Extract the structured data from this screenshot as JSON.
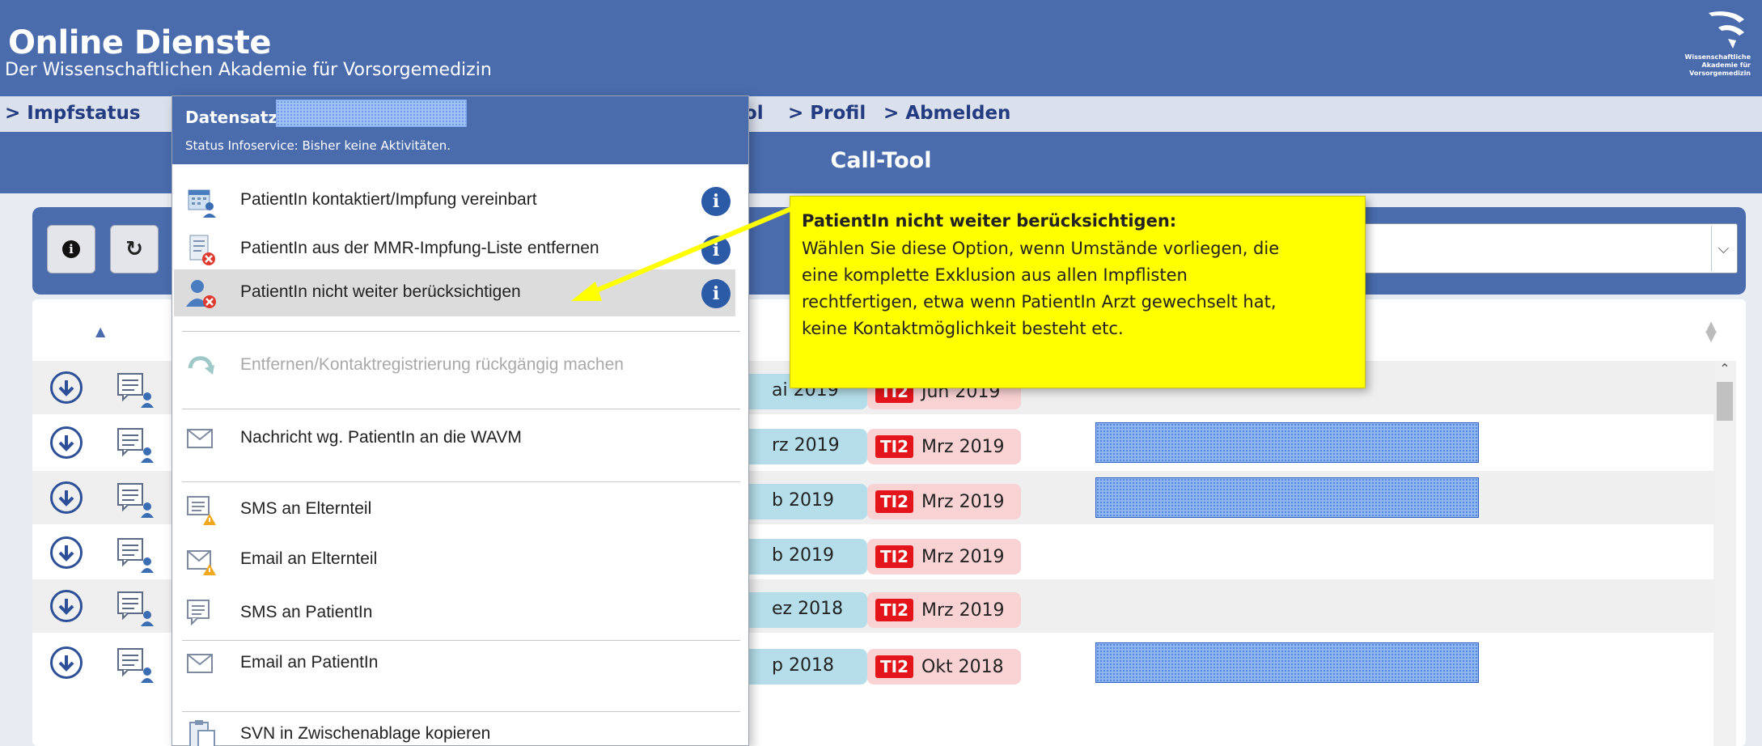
{
  "header": {
    "title": "Online Dienste",
    "subtitle": "Der Wissenschaftlichen Akademie für Vorsorgemedizin",
    "logo_text": [
      "Wissenschaftliche",
      "Akademie für",
      "Vorsorgemedizin"
    ]
  },
  "nav": {
    "impfstatus": "> Impfstatus",
    "tool_fragment": "ol",
    "profil": "> Profil",
    "abmelden": "> Abmelden"
  },
  "titlebar": {
    "title": "Call-Tool"
  },
  "toolbar": {
    "info_icon": "info-icon",
    "refresh_icon": "refresh-icon"
  },
  "menu": {
    "title": "Datensatz",
    "status": "Status Infoservice: Bisher keine Aktivitäten.",
    "items": [
      {
        "label": "PatientIn kontaktiert/Impfung vereinbart",
        "icon": "calendar-user-icon",
        "info": true
      },
      {
        "label": "PatientIn aus der MMR-Impfung-Liste entfernen",
        "icon": "list-remove-icon",
        "info": true
      },
      {
        "label": "PatientIn nicht weiter berücksichtigen",
        "icon": "user-remove-icon",
        "info": true,
        "active": true
      },
      {
        "label": "Entfernen/Kontaktregistrierung rückgängig machen",
        "icon": "undo-icon",
        "disabled": true
      },
      {
        "label": "Nachricht wg. PatientIn an die WAVM",
        "icon": "envelope-icon"
      },
      {
        "label": "SMS an Elternteil",
        "icon": "sms-warning-icon"
      },
      {
        "label": "Email an Elternteil",
        "icon": "email-warning-icon"
      },
      {
        "label": "SMS an PatientIn",
        "icon": "sms-icon"
      },
      {
        "label": "Email an PatientIn",
        "icon": "email-icon"
      },
      {
        "label": "SVN in Zwischenablage kopieren",
        "icon": "clipboard-icon"
      }
    ]
  },
  "tooltip": {
    "title": "PatientIn nicht weiter berücksichtigen:",
    "lines": [
      "Wählen Sie diese Option, wenn Umstände vorliegen, die",
      "eine komplette Exklusion aus allen Impflisten",
      "rechtfertigen, etwa wenn PatientIn Arzt gewechselt hat,",
      "keine Kontaktmöglichkeit besteht etc."
    ]
  },
  "table": {
    "ti_tag": "TI2",
    "rows": [
      {
        "date": "ai 2019",
        "ti": "Jun 2019",
        "redacted": false
      },
      {
        "date": "rz 2019",
        "ti": "Mrz 2019",
        "redacted": true
      },
      {
        "date": "b 2019",
        "ti": "Mrz 2019",
        "redacted": true
      },
      {
        "date": "b 2019",
        "ti": "Mrz 2019",
        "redacted": false
      },
      {
        "date": "ez 2018",
        "ti": "Mrz 2019",
        "redacted": false
      },
      {
        "date": "p 2018",
        "ti": "Okt 2018",
        "redacted": true
      }
    ]
  },
  "colors": {
    "primary": "#4a6cad",
    "tooltip": "#ffff00",
    "ti_tag": "#e4141b",
    "info": "#2b5aa6"
  }
}
